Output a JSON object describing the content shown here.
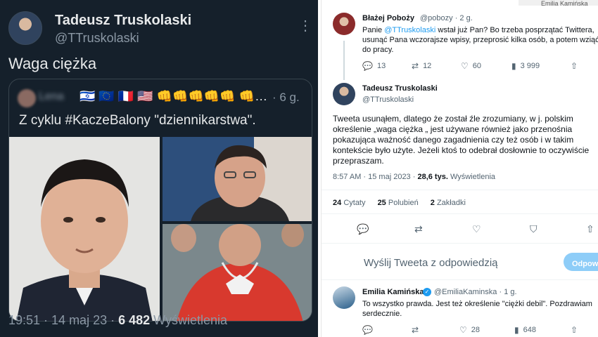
{
  "left_tweet": {
    "author_name": "Tadeusz Truskolaski",
    "author_handle": "@TTruskolaski",
    "more_icon": "more-dots-icon",
    "text": "Waga ciężka",
    "quoted": {
      "author_name_blurred": "Lena",
      "emojis": "🇮🇱 🇪🇺 🇫🇷 🇺🇸 👊👊👊👊👊 👊…",
      "time": "· 6 g.",
      "text": "Z cyklu #KaczeBalony \"dziennikarstwa\"."
    },
    "footer": {
      "datetime": "19:51 · 14 maj 23 ·",
      "views_count": "6 482",
      "views_label": "Wyświetlenia"
    }
  },
  "right_thread": {
    "top_strip": "Emilia Kamińska",
    "parent": {
      "author_name": "Błażej Poboży",
      "author_handle": "@pobozy",
      "time": "· 2 g.",
      "text_before": "Panie ",
      "mention": "@TTruskolaski",
      "text_after": " wstał już Pan? Bo trzeba posprzątać Twittera, usunąć Pana wczorajsze wpisy, przeprosić kilka osób, a potem wziąć do pracy.",
      "actions": {
        "replies": "13",
        "retweets": "12",
        "likes": "60",
        "views": "3 999"
      }
    },
    "main": {
      "author_name": "Tadeusz Truskolaski",
      "author_handle": "@TTruskolaski",
      "text": "Tweeta usunąłem, dlatego że został źle zrozumiany, w j. polskim określenie „waga ciężka „ jest używane również jako przenośnia pokazująca ważność danego zagadnienia czy też osób i w takim kontekście było użyte. Jeżeli ktoś to odebrał dosłownie to oczywiście przepraszam.",
      "timestamp": "8:57 AM · 15 maj 2023 ·",
      "views_count": "28,6 tys.",
      "views_label": "Wyświetlenia",
      "stats": {
        "quotes_count": "24",
        "quotes_label": "Cytaty",
        "likes_count": "25",
        "likes_label": "Polubień",
        "bookmarks_count": "2",
        "bookmarks_label": "Zakładki"
      }
    },
    "reply_box": {
      "placeholder": "Wyślij Tweeta z odpowiedzią",
      "button_label": "Odpowiedz"
    },
    "reply": {
      "author_name": "Emilia Kamińska",
      "author_handle": "@EmiliaKaminska",
      "time": "· 1 g.",
      "text": "To wszystko prawda. Jest też określenie \"ciężki debil\". Pozdrawiam serdecznie.",
      "actions": {
        "likes": "28",
        "views": "648"
      }
    }
  }
}
